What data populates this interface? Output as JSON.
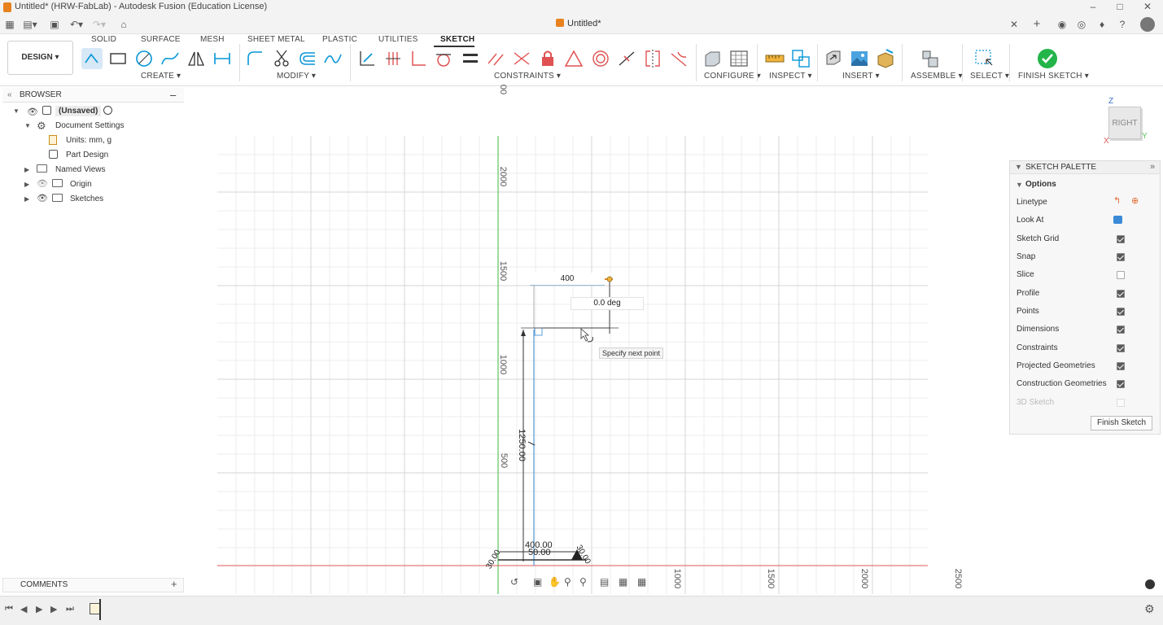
{
  "window": {
    "title": "Untitled* (HRW-FabLab) - Autodesk Fusion (Education License)",
    "document_tab": "Untitled*"
  },
  "ribbon": {
    "workspace": "DESIGN",
    "tabs": [
      "SOLID",
      "SURFACE",
      "MESH",
      "SHEET METAL",
      "PLASTIC",
      "UTILITIES",
      "SKETCH"
    ],
    "active_tab": "SKETCH",
    "groups": [
      "CREATE",
      "MODIFY",
      "CONSTRAINTS",
      "CONFIGURE",
      "INSPECT",
      "INSERT",
      "ASSEMBLE",
      "SELECT",
      "FINISH SKETCH"
    ]
  },
  "browser": {
    "title": "BROWSER",
    "items": [
      {
        "label": "(Unsaved)"
      },
      {
        "label": "Document Settings"
      },
      {
        "label": "Units: mm, g"
      },
      {
        "label": "Part Design"
      },
      {
        "label": "Named Views"
      },
      {
        "label": "Origin"
      },
      {
        "label": "Sketches"
      }
    ]
  },
  "comments": {
    "label": "COMMENTS"
  },
  "sketch_palette": {
    "title": "SKETCH PALETTE",
    "section": "Options",
    "options": [
      {
        "label": "Linetype",
        "state": "icons"
      },
      {
        "label": "Look At",
        "state": "icon"
      },
      {
        "label": "Sketch Grid",
        "state": "on"
      },
      {
        "label": "Snap",
        "state": "on"
      },
      {
        "label": "Slice",
        "state": "off"
      },
      {
        "label": "Profile",
        "state": "on"
      },
      {
        "label": "Points",
        "state": "on"
      },
      {
        "label": "Dimensions",
        "state": "on"
      },
      {
        "label": "Constraints",
        "state": "on"
      },
      {
        "label": "Projected Geometries",
        "state": "on"
      },
      {
        "label": "Construction Geometries",
        "state": "on"
      },
      {
        "label": "3D Sketch",
        "state": "disabled"
      }
    ],
    "finish_button": "Finish Sketch"
  },
  "viewcube": {
    "face": "RIGHT",
    "axis_z": "Z",
    "axis_y": "Y",
    "axis_x": "X"
  },
  "canvas": {
    "vertical_ticks": [
      "00",
      "2000",
      "1500",
      "1000",
      "500"
    ],
    "horizontal_ticks": [
      "1000",
      "1500",
      "2000",
      "2500"
    ],
    "length_input": "400",
    "angle_input": "0.0 deg",
    "tooltip": "Specify next point",
    "dim_height": "1250.00",
    "dim_width": "400.00",
    "dim_inner": "50.00",
    "dim_left": "30.00",
    "dim_right": "30.00"
  },
  "colors": {
    "accent": "#0696d7",
    "finish_green": "#24b54a",
    "axis_green": "#5ec45e",
    "axis_red": "#e05858",
    "sketch_blue": "#5aa0dc"
  }
}
